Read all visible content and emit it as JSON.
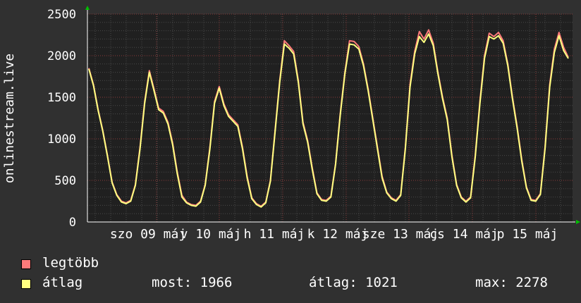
{
  "chart_data": {
    "type": "line",
    "ylabel": "onlinestream.live",
    "ylim": [
      0,
      2500
    ],
    "y_ticks": [
      "0",
      "500",
      "1000",
      "1500",
      "2000",
      "2500"
    ],
    "x_tick_labels": [
      "szo 09 máj",
      "v 10 máj",
      "h 11 máj",
      "k 12 máj",
      "sze 13 máj",
      "cs 14 máj",
      "p 15 máj"
    ],
    "series": [
      {
        "name": "legtöbb",
        "color": "#ff7b7b",
        "values": [
          1850,
          1650,
          1350,
          1100,
          800,
          480,
          330,
          250,
          230,
          260,
          450,
          900,
          1450,
          1820,
          1600,
          1370,
          1330,
          1200,
          950,
          600,
          320,
          240,
          210,
          200,
          250,
          450,
          900,
          1450,
          1630,
          1420,
          1290,
          1230,
          1170,
          900,
          550,
          290,
          220,
          190,
          240,
          500,
          1100,
          1700,
          2180,
          2120,
          2050,
          1700,
          1200,
          980,
          650,
          350,
          270,
          260,
          310,
          700,
          1300,
          1800,
          2180,
          2170,
          2110,
          1900,
          1600,
          1250,
          900,
          550,
          360,
          290,
          260,
          330,
          900,
          1650,
          2050,
          2290,
          2200,
          2310,
          2150,
          1800,
          1500,
          1250,
          800,
          450,
          300,
          250,
          300,
          800,
          1450,
          2000,
          2270,
          2230,
          2280,
          2180,
          1900,
          1500,
          1150,
          750,
          420,
          270,
          260,
          340,
          900,
          1650,
          2080,
          2280,
          2100,
          1980
        ]
      },
      {
        "name": "átlag",
        "color": "#ffff80",
        "values": [
          1840,
          1640,
          1340,
          1090,
          790,
          470,
          320,
          240,
          220,
          250,
          440,
          880,
          1430,
          1800,
          1580,
          1350,
          1310,
          1180,
          930,
          580,
          300,
          230,
          200,
          190,
          240,
          440,
          880,
          1430,
          1610,
          1400,
          1270,
          1210,
          1150,
          880,
          530,
          280,
          210,
          180,
          230,
          490,
          1080,
          1680,
          2140,
          2090,
          2020,
          1680,
          1180,
          960,
          630,
          340,
          260,
          250,
          300,
          690,
          1280,
          1780,
          2140,
          2130,
          2080,
          1880,
          1580,
          1230,
          880,
          530,
          350,
          280,
          250,
          320,
          880,
          1620,
          2020,
          2230,
          2160,
          2260,
          2120,
          1780,
          1480,
          1230,
          780,
          440,
          290,
          240,
          290,
          780,
          1420,
          1970,
          2230,
          2200,
          2240,
          2150,
          1880,
          1480,
          1130,
          730,
          410,
          260,
          250,
          330,
          880,
          1620,
          2040,
          2240,
          2060,
          1966
        ]
      }
    ],
    "grid": true,
    "legend_placement": "bottom-left"
  },
  "legend": {
    "items": [
      {
        "label": "legtöbb",
        "color": "#ff7b7b"
      },
      {
        "label": "átlag",
        "color": "#ffff80"
      }
    ]
  },
  "stats": {
    "now": "most: 1966",
    "avg": "átlag: 1021",
    "max": "max: 2278"
  }
}
